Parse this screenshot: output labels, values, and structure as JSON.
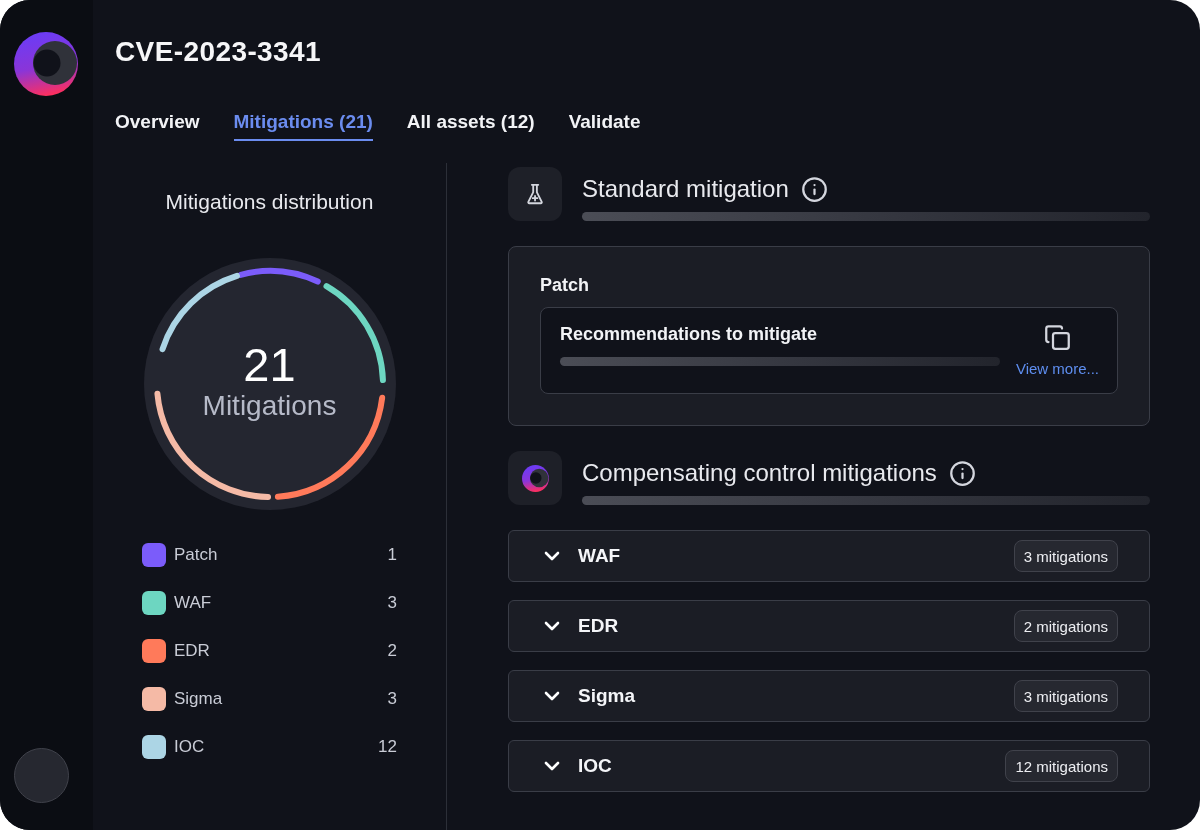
{
  "header": {
    "title": "CVE-2023-3341"
  },
  "tabs": [
    {
      "label": "Overview",
      "selected": false
    },
    {
      "label": "Mitigations (21)",
      "selected": true
    },
    {
      "label": "All assets (12)",
      "selected": false
    },
    {
      "label": "Validate",
      "selected": false
    }
  ],
  "distribution": {
    "title": "Mitigations distribution",
    "total": "21",
    "total_label": "Mitigations",
    "legend": [
      {
        "label": "Patch",
        "count": "1",
        "color": "#7b5cfa"
      },
      {
        "label": "WAF",
        "count": "3",
        "color": "#6dd6c1"
      },
      {
        "label": "EDR",
        "count": "2",
        "color": "#ff7a5a"
      },
      {
        "label": "Sigma",
        "count": "3",
        "color": "#f5baa6"
      },
      {
        "label": "IOC",
        "count": "12",
        "color": "#acd5e5"
      }
    ]
  },
  "standard_mitigation": {
    "title": "Standard mitigation",
    "card": {
      "title": "Patch",
      "recommendation": {
        "title": "Recommendations to mitigate",
        "link": "View more..."
      }
    }
  },
  "compensating": {
    "title": "Compensating control mitigations",
    "groups": [
      {
        "label": "WAF",
        "badge": "3 mitigations",
        "expanded": false
      },
      {
        "label": "EDR",
        "badge": "2 mitigations",
        "expanded": false
      },
      {
        "label": "Sigma",
        "badge": "3 mitigations",
        "expanded": false
      },
      {
        "label": "IOC",
        "badge": "12 mitigations",
        "expanded": false
      }
    ]
  }
}
